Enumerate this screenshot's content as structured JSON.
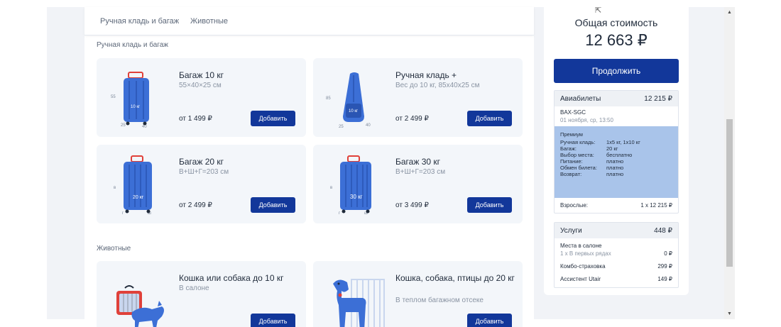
{
  "tabs": [
    "Ручная кладь и багаж",
    "Животные"
  ],
  "sections": {
    "baggage_title": "Ручная кладь и багаж",
    "pets_title": "Животные"
  },
  "cards": [
    {
      "title": "Багаж 10 кг",
      "sub": "55×40×25 см",
      "price": "от 1 499 ₽",
      "button": "Добавить",
      "icon": "suitcase-10kg-icon",
      "badge": "10 кг",
      "dims": [
        "55",
        "25",
        "40"
      ]
    },
    {
      "title": "Ручная кладь +",
      "sub": "Вес до 10 кг, 85х40х25 см",
      "price": "от 2 499 ₽",
      "button": "Добавить",
      "icon": "garment-bag-icon",
      "badge": "10 кг",
      "dims": [
        "85",
        "25",
        "40"
      ]
    },
    {
      "title": "Багаж 20 кг",
      "sub": "В+Ш+Г=203 см",
      "price": "от 2 499 ₽",
      "button": "Добавить",
      "icon": "suitcase-20kg-icon",
      "badge": "20 кг",
      "dims": [
        "в",
        "г",
        "ш"
      ]
    },
    {
      "title": "Багаж 30 кг",
      "sub": "В+Ш+Г=203 см",
      "price": "от 3 499 ₽",
      "button": "Добавить",
      "icon": "suitcase-30kg-icon",
      "badge": "30 кг",
      "dims": [
        "в",
        "г",
        "ш"
      ]
    },
    {
      "title": "Кошка или собака до 10 кг",
      "sub": "В салоне",
      "price": "",
      "button": "Добавить",
      "icon": "pet-carrier-cat-icon"
    },
    {
      "title": "Кошка, собака, птицы до 20 кг",
      "sub": "В теплом багажном отсеке",
      "price": "",
      "button": "Добавить",
      "icon": "dog-cage-icon"
    }
  ],
  "summary": {
    "total_label": "Общая стоимость",
    "total_value": "12 663 ₽",
    "continue_label": "Продолжить",
    "tickets": {
      "label": "Авиабилеты",
      "amount": "12 215 ₽",
      "route": "BAX-SGC",
      "date": "01 ноября, ср, 13:50",
      "tariff_name": "Премиум",
      "tariff_rows": [
        {
          "k": "Ручная кладь:",
          "v": "1х5 кг, 1х10 кг"
        },
        {
          "k": "Багаж:",
          "v": "20 кг"
        },
        {
          "k": "Выбор места:",
          "v": "бесплатно"
        },
        {
          "k": "Питание:",
          "v": "платно"
        },
        {
          "k": "Обмен билета:",
          "v": "платно"
        },
        {
          "k": "Возврат:",
          "v": "платно"
        }
      ],
      "adults_label": "Взрослые:",
      "adults_value": "1 x 12 215 ₽"
    },
    "services": {
      "label": "Услуги",
      "amount": "448 ₽",
      "items": [
        {
          "name": "Места в салоне",
          "sub": "1 x В первых рядах",
          "price": "0 ₽"
        },
        {
          "name": "Комбо-страховка",
          "sub": "",
          "price": "299 ₽"
        },
        {
          "name": "Ассистент Utair",
          "sub": "",
          "price": "149 ₽"
        }
      ]
    }
  },
  "colors": {
    "primary": "#12379a",
    "suitcase": "#3c6fd6",
    "tariff_bg": "#a9c4ea",
    "handle": "#e0413a"
  }
}
